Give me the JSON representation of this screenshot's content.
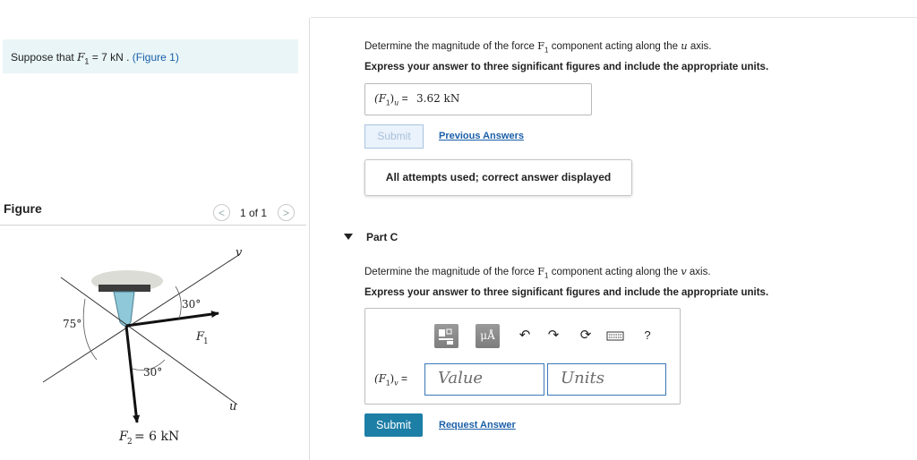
{
  "problem": {
    "prompt_prefix": "Suppose that",
    "prompt_var": "F",
    "prompt_sub": "1",
    "prompt_value": "= 7 kN .",
    "figure_link": "(Figure 1)"
  },
  "figure_panel": {
    "title": "Figure",
    "pager_prev": "<",
    "pager_text": "1 of 1",
    "pager_next": ">",
    "labels": {
      "v_axis": "v",
      "u_axis": "u",
      "f1": "F",
      "f1_sub": "1",
      "f2": "F",
      "f2_sub": "2",
      "f2_value": "= 6 kN",
      "angle_75": "75°",
      "angle_30_top": "30°",
      "angle_30_bottom": "30°"
    }
  },
  "part_b": {
    "question_prefix": "Determine the magnitude of the force",
    "question_var": "F",
    "question_sub": "1",
    "question_suffix": "component acting along the",
    "question_axis": "u",
    "question_end": "axis.",
    "instruction": "Express your answer to three significant figures and include the appropriate units.",
    "answer_var": "F",
    "answer_sub": "1",
    "answer_axis_sub": "u",
    "answer_eq": "=",
    "answer_value": "3.62 kN",
    "submit_label": "Submit",
    "previous_answers_label": "Previous Answers",
    "status_message": "All attempts used; correct answer displayed"
  },
  "part_c": {
    "title": "Part C",
    "question_prefix": "Determine the magnitude of the force",
    "question_var": "F",
    "question_sub": "1",
    "question_suffix": "component acting along the",
    "question_axis": "v",
    "question_end": "axis.",
    "instruction": "Express your answer to three significant figures and include the appropriate units.",
    "toolbar": {
      "templates_icon": "templates-icon",
      "units_label": "μÅ",
      "undo_icon": "undo-icon",
      "redo_icon": "redo-icon",
      "reset_icon": "reset-icon",
      "keyboard_icon": "keyboard-icon",
      "help_label": "?"
    },
    "answer_var": "F",
    "answer_sub": "1",
    "answer_axis_sub": "v",
    "answer_eq": "=",
    "value_placeholder": "Value",
    "units_placeholder": "Units",
    "submit_label": "Submit",
    "request_answer_label": "Request Answer"
  },
  "colors": {
    "accent_blue": "#1d7ea6",
    "link_blue": "#1a5fa8",
    "prompt_bg": "#e9f5f7",
    "support_teal": "#8fc8d8"
  }
}
